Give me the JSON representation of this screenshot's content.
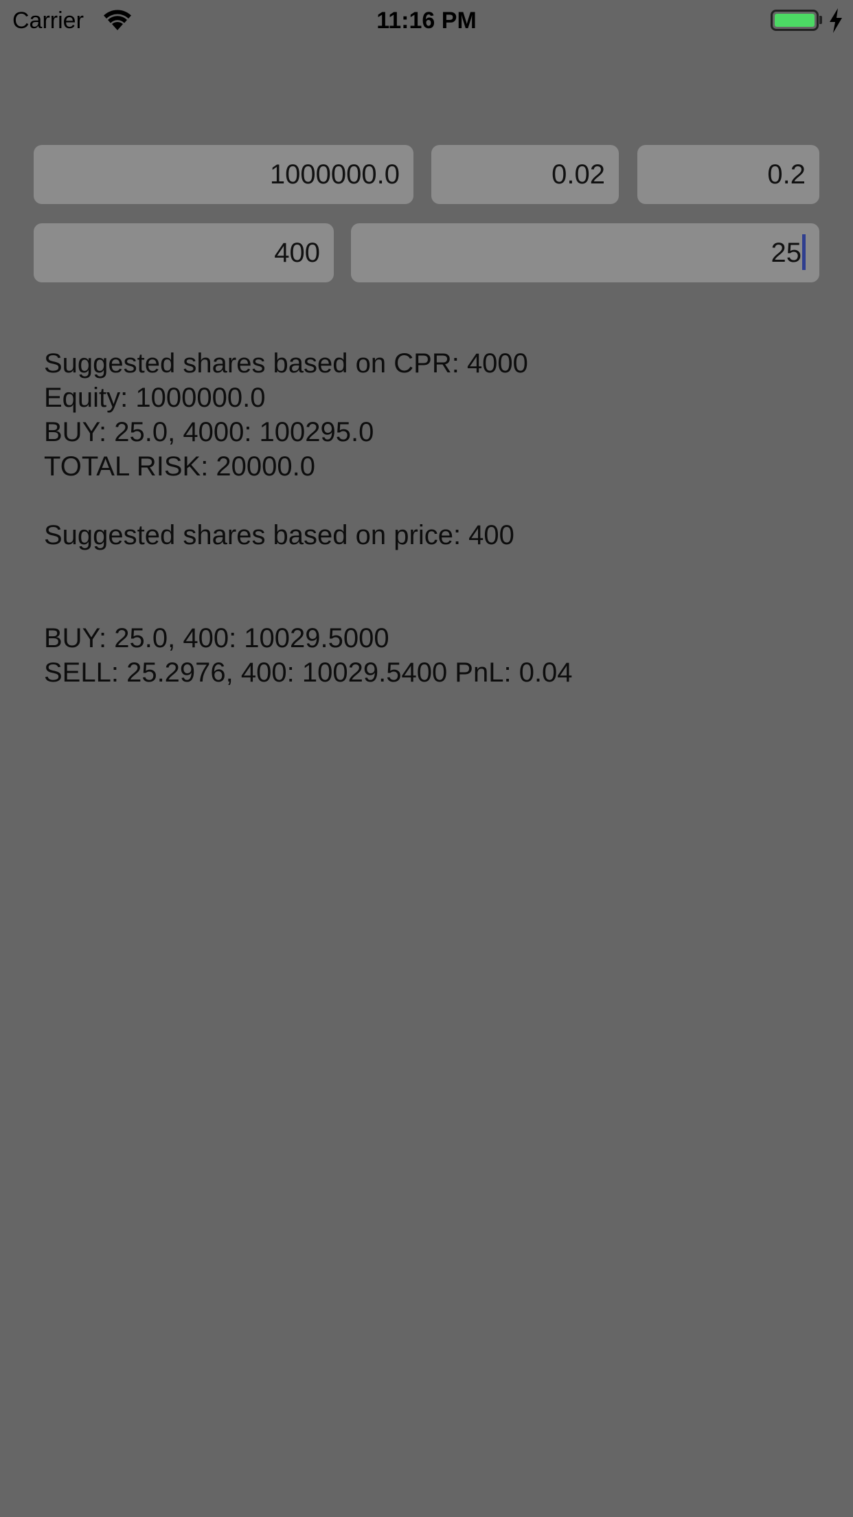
{
  "status_bar": {
    "carrier": "Carrier",
    "time": "11:16 PM",
    "battery_color": "#4cd964"
  },
  "inputs": {
    "equity": "1000000.0",
    "risk": "0.02",
    "percent": "0.2",
    "price": "400",
    "shares": "25"
  },
  "results": {
    "cpr_line": "Suggested shares based on CPR: 4000",
    "equity_line": "Equity: 1000000.0",
    "buy_cpr_line": "BUY: 25.0, 4000: 100295.0",
    "total_risk_line": "TOTAL RISK: 20000.0",
    "price_line": "Suggested shares based on price: 400",
    "buy_price_line": "BUY: 25.0, 400: 10029.5000",
    "sell_line": "SELL: 25.2976, 400: 10029.5400 PnL: 0.04"
  },
  "colors": {
    "background": "#666666",
    "field": "#8c8c8c",
    "caret": "#2f3e8f"
  }
}
